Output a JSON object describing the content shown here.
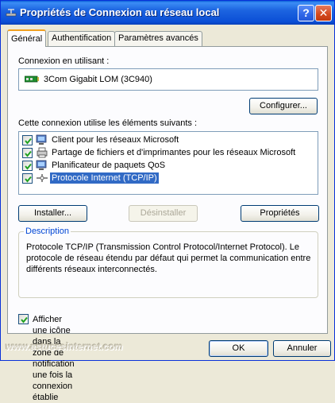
{
  "window": {
    "title": "Propriétés de Connexion au réseau local",
    "help_glyph": "?",
    "close_glyph": "✕",
    "icon": "network-connection-icon"
  },
  "tabs": [
    {
      "label": "Général",
      "active": true
    },
    {
      "label": "Authentification",
      "active": false
    },
    {
      "label": "Paramètres avancés",
      "active": false
    }
  ],
  "general": {
    "connect_using_label": "Connexion en utilisant :",
    "adapter": {
      "name": "3Com Gigabit LOM (3C940)",
      "icon": "network-card-icon"
    },
    "configure_button": "Configurer...",
    "components_label": "Cette connexion utilise les éléments suivants :",
    "components": [
      {
        "label": "Client pour les réseaux Microsoft",
        "checked": true,
        "selected": false,
        "icon": "client-network-icon"
      },
      {
        "label": "Partage de fichiers et d'imprimantes pour les réseaux Microsoft",
        "checked": true,
        "selected": false,
        "icon": "file-printer-sharing-icon"
      },
      {
        "label": "Planificateur de paquets QoS",
        "checked": true,
        "selected": false,
        "icon": "qos-scheduler-icon"
      },
      {
        "label": "Protocole Internet (TCP/IP)",
        "checked": true,
        "selected": true,
        "icon": "protocol-icon"
      }
    ],
    "install_button": "Installer...",
    "uninstall_button": "Désinstaller",
    "properties_button": "Propriétés",
    "description_title": "Description",
    "description_text": "Protocole TCP/IP (Transmission Control Protocol/Internet Protocol). Le protocole de réseau étendu par défaut qui permet la communication entre différents réseaux interconnectés.",
    "notify_checkbox": {
      "label": "Afficher une icône dans la zone de notification une fois la connexion établie",
      "checked": true
    }
  },
  "watermark": "www.astucesinternet.com",
  "footer": {
    "ok_button": "OK",
    "cancel_button": "Annuler"
  },
  "colors": {
    "titlebar": "#0b4fd6",
    "selection": "#316ac5",
    "group_title": "#0046d5",
    "window_bg": "#ece9d8"
  }
}
